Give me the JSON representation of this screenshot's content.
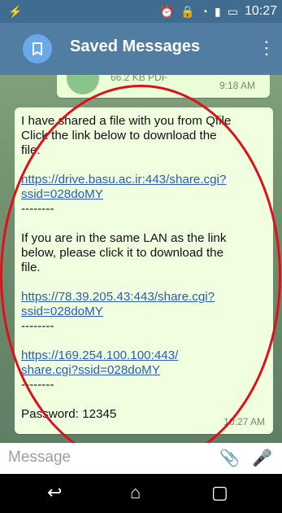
{
  "status": {
    "left_icon": "usb-icon",
    "time": "10:27",
    "icons": [
      "alarm-icon",
      "lock-icon",
      "wifi-icon",
      "signal-icon",
      "battery-icon"
    ]
  },
  "header": {
    "title": "Saved Messages",
    "left_icon": "bookmark-icon",
    "menu_icon": "more-vertical-icon"
  },
  "prev_message": {
    "file_size": "66.2 KB PDF",
    "time": "9:18 AM"
  },
  "message": {
    "line1": "I have shared a file with you from Qfile",
    "line2": "Click the link below to download the",
    "line3": "file:",
    "link1_part1": "https://drive.basu.ac.ir:443/share.cgi?",
    "link1_part2": "ssid=028doMY",
    "sep": "--------",
    "line4": "If you are in the same LAN as the link",
    "line5": "below, please click it to download the",
    "line6": "file.",
    "link2_part1": "https://78.39.205.43:443/share.cgi?",
    "link2_part2": "ssid=028doMY",
    "link3_part1": "https://169.254.100.100:443/",
    "link3_part2": "share.cgi?ssid=028doMY",
    "password": "Password: 12345",
    "time": "10:27 AM"
  },
  "composer": {
    "placeholder": "Message",
    "attach_icon": "paperclip-icon",
    "mic_icon": "microphone-icon"
  },
  "nav": {
    "back_icon": "back-icon",
    "home_icon": "home-icon",
    "recent_icon": "recent-apps-icon"
  },
  "colors": {
    "header": "#517da2",
    "bubble": "#f0ffe0",
    "link": "#2a5db0",
    "annotation": "#e0101a"
  }
}
